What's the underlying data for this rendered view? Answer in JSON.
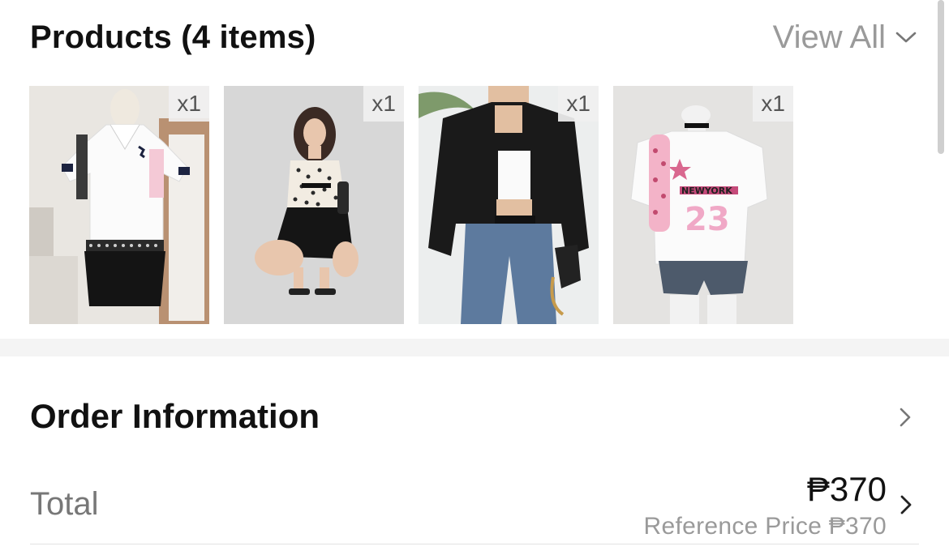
{
  "products": {
    "title": "Products (4 items)",
    "view_all_label": "View All",
    "items": [
      {
        "qty": "x1",
        "image": "white-polo-black-skirt"
      },
      {
        "qty": "x1",
        "image": "polka-dot-top-black-skirt"
      },
      {
        "qty": "x1",
        "image": "black-leather-jacket-jeans"
      },
      {
        "qty": "x1",
        "image": "new-york-tee-denim-shorts"
      }
    ]
  },
  "order": {
    "title": "Order Information",
    "total_label": "Total",
    "total_amount": "₱370",
    "reference_price": "Reference Price ₱370"
  },
  "icons": {
    "view_all": "chevron-down-icon",
    "order": "chevron-right-icon",
    "total": "chevron-right-icon"
  },
  "colors": {
    "text_primary": "#111111",
    "text_muted": "#9a9a9a",
    "band": "#f4f4f4"
  }
}
